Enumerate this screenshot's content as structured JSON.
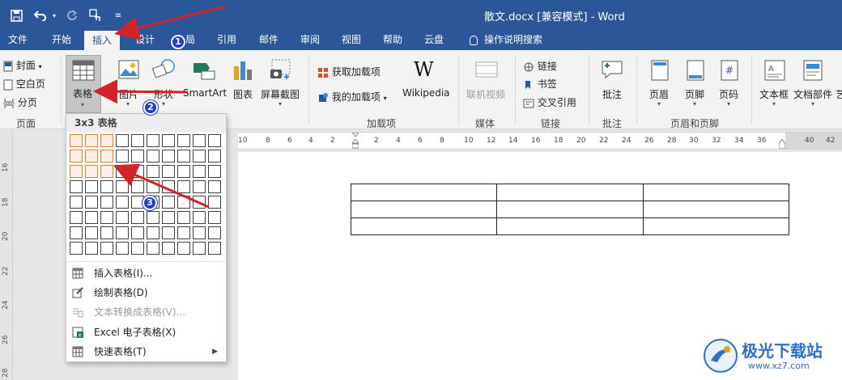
{
  "title_bar": {
    "document_title": "散文.docx [兼容模式]  -  Word",
    "qat_icons": [
      "save-icon",
      "undo-icon",
      "redo-icon",
      "touch-mode-icon",
      "customize-qat-icon"
    ]
  },
  "tabs": [
    {
      "label": "文件",
      "active": false
    },
    {
      "label": "开始",
      "active": false
    },
    {
      "label": "插入",
      "active": true
    },
    {
      "label": "设计",
      "active": false
    },
    {
      "label": "局",
      "active": false
    },
    {
      "label": "引用",
      "active": false
    },
    {
      "label": "邮件",
      "active": false
    },
    {
      "label": "审阅",
      "active": false
    },
    {
      "label": "视图",
      "active": false
    },
    {
      "label": "帮助",
      "active": false
    },
    {
      "label": "云盘",
      "active": false
    }
  ],
  "tell_me": "操作说明搜索",
  "ribbon": {
    "pages": {
      "cover": "封面",
      "blank": "空白页",
      "break": "分页",
      "group": "页面"
    },
    "table": {
      "label": "表格"
    },
    "illustrations": {
      "picture": "图片",
      "shapes": "形状",
      "smartart": "SmartArt",
      "chart": "图表",
      "screenshot": "屏幕截图"
    },
    "addins": {
      "get": "获取加载项",
      "mine": "我的加载项",
      "wikipedia": "Wikipedia",
      "group": "加载项"
    },
    "media": {
      "online_video": "联机视频",
      "group": "媒体"
    },
    "links": {
      "link": "链接",
      "bookmark": "书签",
      "crossref": "交叉引用",
      "group": "链接"
    },
    "comments": {
      "comment": "批注",
      "group": "批注"
    },
    "header_footer": {
      "header": "页眉",
      "footer": "页脚",
      "page_number": "页码",
      "group": "页眉和页脚"
    },
    "text": {
      "textbox": "文本框",
      "quick_parts": "文档部件",
      "art": "艺"
    }
  },
  "table_dropdown": {
    "header": "3x3 表格",
    "grid_cols": 10,
    "grid_rows": 8,
    "selected_cols": 3,
    "selected_rows": 3,
    "items": [
      {
        "label": "插入表格(I)...",
        "icon": "insert-table-icon",
        "disabled": false,
        "submenu": false
      },
      {
        "label": "绘制表格(D)",
        "icon": "draw-table-icon",
        "disabled": false,
        "submenu": false
      },
      {
        "label": "文本转换成表格(V)...",
        "icon": "text-to-table-icon",
        "disabled": true,
        "submenu": false
      },
      {
        "label": "Excel 电子表格(X)",
        "icon": "excel-icon",
        "disabled": false,
        "submenu": false
      },
      {
        "label": "快速表格(T)",
        "icon": "quick-tables-icon",
        "disabled": false,
        "submenu": true
      }
    ]
  },
  "ruler": {
    "horizontal": [
      "10",
      "8",
      "6",
      "4",
      "2",
      "2",
      "4",
      "6",
      "8",
      "10",
      "12",
      "14",
      "16",
      "18",
      "20",
      "22",
      "24",
      "26",
      "28",
      "30",
      "32",
      "34",
      "36",
      "40",
      "42"
    ],
    "vertical": [
      "16",
      "18",
      "20",
      "22",
      "24",
      "26",
      "28"
    ]
  },
  "document_table": {
    "rows": 3,
    "cols": 3
  },
  "annotations": [
    "1",
    "2",
    "3"
  ],
  "watermark": {
    "title": "极光下载站",
    "url": "www.xz7.com"
  },
  "colors": {
    "title_bar": "#2b579a",
    "selection": "#f07b1a",
    "arrow": "#d0232a",
    "badge": "#1f3fd0"
  }
}
